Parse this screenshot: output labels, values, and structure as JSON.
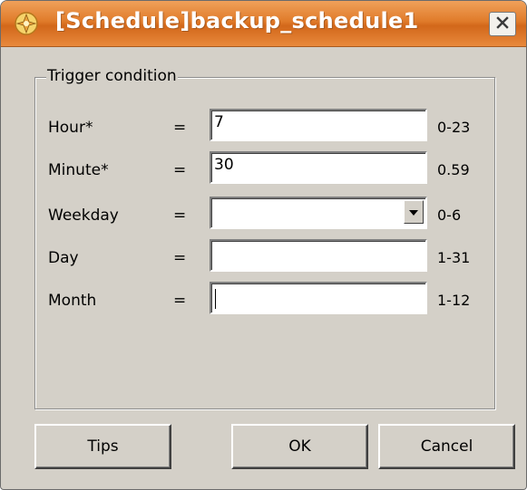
{
  "window": {
    "title": "[Schedule]backup_schedule1",
    "app_icon": "app-icon",
    "close_icon": "close-icon",
    "accent_color": "#e07b2a"
  },
  "group": {
    "legend": "Trigger condition"
  },
  "fields": [
    {
      "label": "Hour*",
      "operator": "=",
      "value": "7",
      "range": "0-23",
      "type": "text"
    },
    {
      "label": "Minute*",
      "operator": "=",
      "value": "30",
      "range": "0.59",
      "type": "text"
    },
    {
      "label": "Weekday",
      "operator": "=",
      "value": "",
      "range": "0-6",
      "type": "select"
    },
    {
      "label": "Day",
      "operator": "=",
      "value": "",
      "range": "1-31",
      "type": "text"
    },
    {
      "label": "Month",
      "operator": "=",
      "value": "",
      "range": "1-12",
      "type": "text"
    }
  ],
  "buttons": {
    "tips": "Tips",
    "ok": "OK",
    "cancel": "Cancel"
  }
}
